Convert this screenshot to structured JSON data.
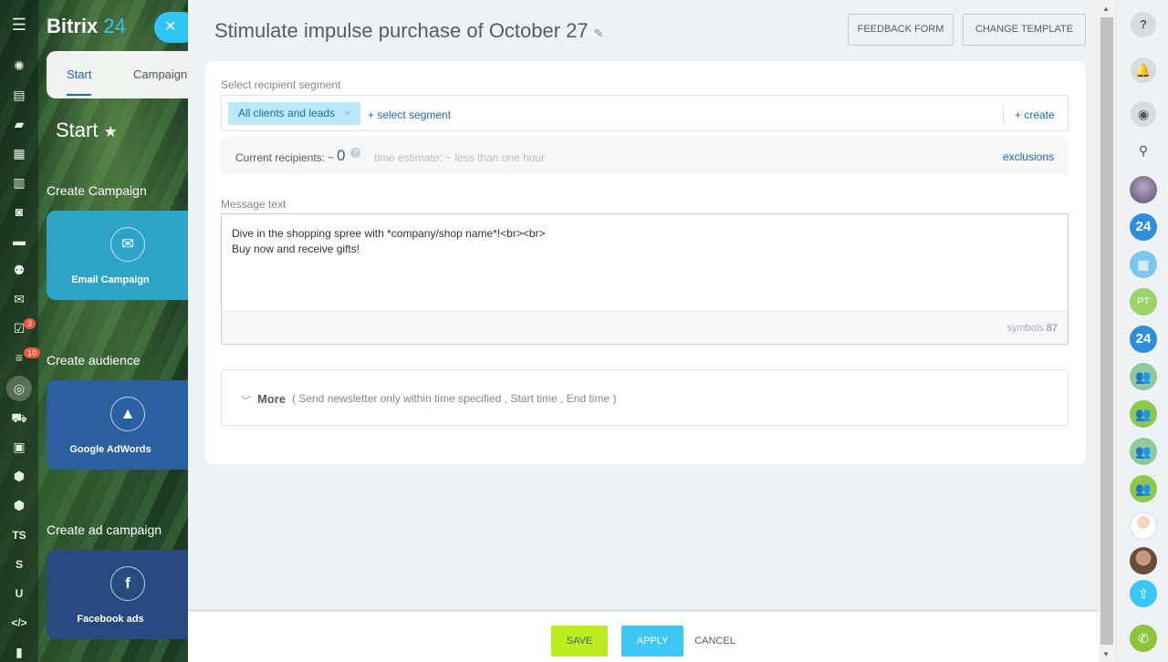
{
  "app": {
    "logo_main": "Bitrix",
    "logo_num": "24",
    "close_glyph": "✕"
  },
  "left_rail": {
    "icons": [
      "menu-icon",
      "stream-icon",
      "tasks-icon",
      "chat-icon",
      "calendar-icon",
      "docs-icon",
      "robot-icon",
      "drive-icon",
      "groups-icon",
      "mail-icon",
      "checklist-icon",
      "filter-icon",
      "marketing-icon",
      "cart-icon",
      "contact-center-icon",
      "box-icon",
      "box2-icon",
      "ts-text-icon",
      "s-text-icon",
      "u-text-icon",
      "code-icon",
      "more-icon"
    ],
    "text_icons": {
      "ts": "TS",
      "s": "S",
      "u": "U",
      "code": "</>"
    },
    "badges": {
      "tasks": "3",
      "filter": "10"
    }
  },
  "sidebar": {
    "tabs": [
      "Start",
      "Campaign"
    ],
    "title": "Start",
    "sections": [
      {
        "title": "Create Campaign",
        "tile_label": "Email Campaign",
        "tile_color": "#2ea3c8"
      },
      {
        "title": "Create audience",
        "tile_label": "Google AdWords",
        "tile_color": "#2a5fa0"
      },
      {
        "title": "Create ad campaign",
        "tile_label": "Facebook ads",
        "tile_color": "#274a80"
      }
    ],
    "icon_glyphs": {
      "email": "✉",
      "adwords": "▲",
      "facebook": "f"
    }
  },
  "header": {
    "title": "Stimulate impulse purchase of October 27",
    "feedback_label": "FEEDBACK FORM",
    "template_label": "CHANGE TEMPLATE"
  },
  "segment": {
    "label": "Select recipient segment",
    "chip": "All clients and leads",
    "chip_close": "×",
    "select_link": "+ select segment",
    "create_link": "+ create"
  },
  "recipients": {
    "label": "Current recipients: ~",
    "count": "0",
    "help": "?",
    "estimate": "time estimate: ~ less than one hour",
    "exclusions": "exclusions"
  },
  "message": {
    "label": "Message text",
    "line1": "Dive in the shopping spree with *company/shop name*!<br><br>",
    "line2": "Buy now and receive gifts!",
    "symbols_label": "symbols",
    "symbols_count": "87"
  },
  "more": {
    "label": "More",
    "params": "( Send newsletter only within time specified ,  Start time ,  End time  )"
  },
  "footer": {
    "save": "SAVE",
    "apply": "APPLY",
    "cancel": "CANCEL"
  },
  "right_rail": {
    "help": "?",
    "b24": "24",
    "pt": "PT"
  },
  "colors": {
    "accent": "#2fc6f6",
    "save": "#bbed21",
    "apply": "#3bc8f5",
    "link": "#2067b0"
  }
}
